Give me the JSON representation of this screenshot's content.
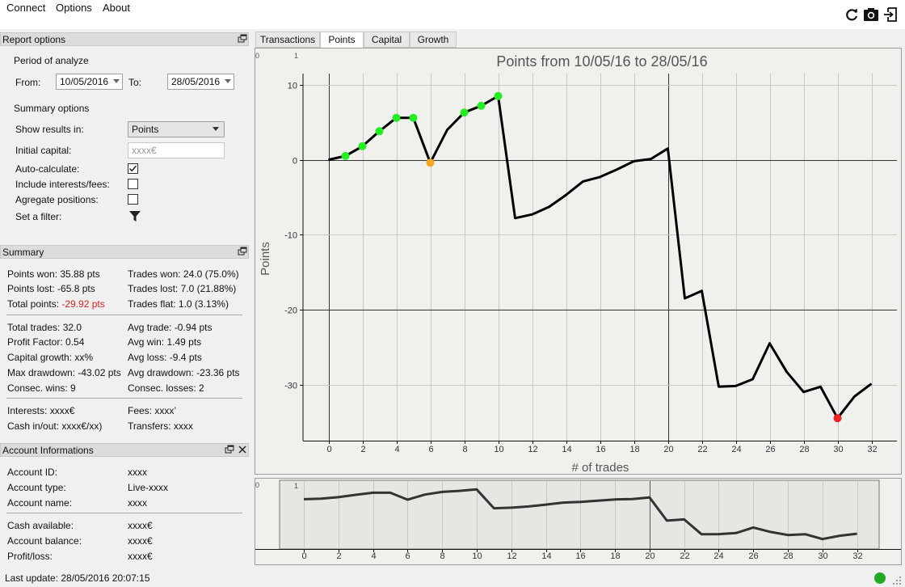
{
  "menu": [
    "Connect",
    "Options",
    "About"
  ],
  "toolbar_icons": [
    "refresh-icon",
    "camera-icon",
    "export-icon"
  ],
  "report_options": {
    "header": "Report options",
    "period_label": "Period of analyze",
    "from_label": "From:",
    "from_value": "10/05/2016",
    "to_label": "To:",
    "to_value": "28/05/2016",
    "summary_options_label": "Summary options",
    "show_results_label": "Show results in:",
    "show_results_value": "Points",
    "initial_capital_label": "Initial capital:",
    "initial_capital_placeholder": "xxxx€",
    "auto_calculate_label": "Auto-calculate:",
    "auto_calculate_checked": true,
    "include_interests_label": "Include interests/fees:",
    "include_interests_checked": false,
    "aggregate_label": "Agregate positions:",
    "aggregate_checked": false,
    "filter_label": "Set a filter:"
  },
  "summary": {
    "header": "Summary",
    "left": [
      "Points won: 35.88 pts",
      "Points lost: -65.8 pts",
      "Total points: "
    ],
    "total_points_value": "-29.92 pts",
    "right": [
      "Trades won: 24.0 (75.0%)",
      "Trades lost: 7.0 (21.88%)",
      "Trades flat: 1.0 (3.13%)"
    ],
    "left2": [
      "Total trades: 32.0",
      "Profit Factor: 0.54",
      "Capital growth: xx%",
      "Max drawdown: -43.02 pts",
      "Consec. wins: 9"
    ],
    "right2": [
      "Avg trade: -0.94 pts",
      "Avg win: 1.49 pts",
      "Avg loss: -9.4 pts",
      "Avg drawdown: -23.36 pts",
      "Consec. losses: 2"
    ],
    "left3": [
      "Interests: xxxx€",
      "Cash in/out: xxxx€/xx)"
    ],
    "right3": [
      "Fees: xxxx’",
      "Transfers: xxxx"
    ]
  },
  "account": {
    "header": "Account Informations",
    "labels": [
      "Account ID:",
      "Account type:",
      "Account name:"
    ],
    "values": [
      "xxxx",
      "Live-xxxx",
      "xxxx"
    ],
    "labels2": [
      "Cash available:",
      "Account balance:",
      "Profit/loss:"
    ],
    "values2": [
      "xxxx€",
      "xxxx€",
      "xxxx€"
    ]
  },
  "tabs": [
    "Transactions",
    "Points",
    "Capital",
    "Growth"
  ],
  "active_tab": "Points",
  "status": {
    "last_update": "Last update: 28/05/2016 20:07:15",
    "connection_color": "#22aa22"
  },
  "chart_data": {
    "type": "line",
    "title": "Points from 10/05/16 to 28/05/16",
    "xlabel": "# of trades",
    "ylabel": "Points",
    "xlim": [
      -1.5,
      33.5
    ],
    "ylim": [
      -37.5,
      11.5
    ],
    "xticks": [
      0,
      2,
      4,
      6,
      8,
      10,
      12,
      14,
      16,
      18,
      20,
      22,
      24,
      26,
      28,
      30,
      32
    ],
    "yticks": [
      10,
      0,
      -10,
      -20,
      -30
    ],
    "grid": true,
    "corner_labels": [
      "0",
      "1"
    ],
    "x": [
      0,
      1,
      2,
      3,
      4,
      5,
      6,
      7,
      8,
      9,
      10,
      11,
      12,
      13,
      14,
      15,
      16,
      17,
      18,
      19,
      20,
      21,
      22,
      23,
      24,
      25,
      26,
      27,
      28,
      29,
      30,
      31,
      32
    ],
    "y": [
      0,
      0.5,
      1.8,
      3.8,
      5.6,
      5.6,
      -0.4,
      4.0,
      6.3,
      7.2,
      8.5,
      -7.8,
      -7.3,
      -6.3,
      -4.7,
      -2.9,
      -2.3,
      -1.3,
      -0.2,
      0.1,
      1.5,
      -18.5,
      -17.5,
      -30.3,
      -30.2,
      -29.3,
      -24.5,
      -28.3,
      -31.0,
      -30.3,
      -34.5,
      -31.6,
      -29.9
    ],
    "highlight_points": [
      {
        "x": 1,
        "y": 0.5,
        "color": "#22ee22"
      },
      {
        "x": 2,
        "y": 1.8,
        "color": "#22ee22"
      },
      {
        "x": 3,
        "y": 3.8,
        "color": "#22ee22"
      },
      {
        "x": 4,
        "y": 5.6,
        "color": "#22ee22"
      },
      {
        "x": 5,
        "y": 5.6,
        "color": "#22ee22"
      },
      {
        "x": 6,
        "y": -0.4,
        "color": "#f5a623"
      },
      {
        "x": 8,
        "y": 6.3,
        "color": "#22ee22"
      },
      {
        "x": 9,
        "y": 7.2,
        "color": "#22ee22"
      },
      {
        "x": 10,
        "y": 8.5,
        "color": "#22ee22"
      },
      {
        "x": 30,
        "y": -34.5,
        "color": "#ee2222"
      }
    ],
    "overview": {
      "corner_labels": [
        "0",
        "1"
      ],
      "xticks": [
        0,
        2,
        4,
        6,
        8,
        10,
        12,
        14,
        16,
        18,
        20,
        22,
        24,
        26,
        28,
        30,
        32
      ]
    }
  }
}
